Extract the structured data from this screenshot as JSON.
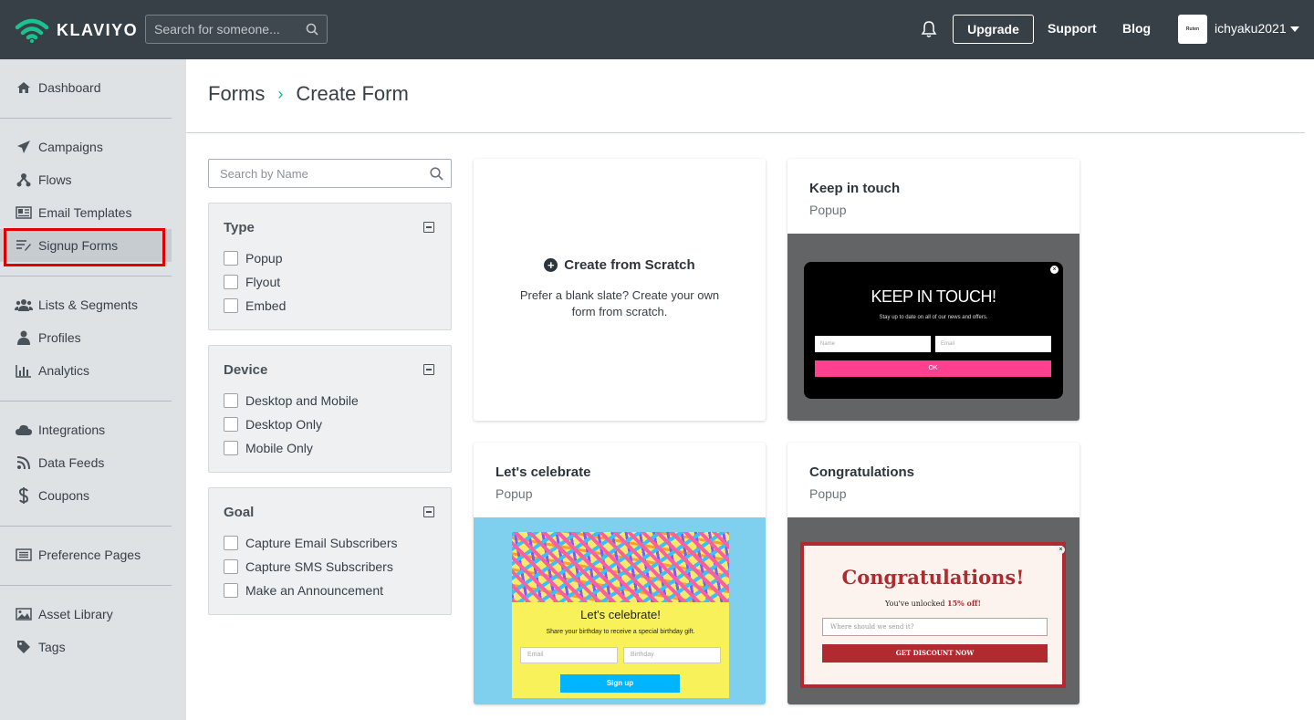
{
  "header": {
    "brand": "KLAVIYO",
    "search_placeholder": "Search for someone...",
    "upgrade_label": "Upgrade",
    "support_label": "Support",
    "blog_label": "Blog",
    "avatar_text": "Ruten",
    "username": "ichyaku2021"
  },
  "sidebar": {
    "items": [
      {
        "label": "Dashboard",
        "icon": "home-icon"
      },
      {
        "label": "Campaigns",
        "icon": "paper-plane-icon"
      },
      {
        "label": "Flows",
        "icon": "flows-icon"
      },
      {
        "label": "Email Templates",
        "icon": "template-icon"
      },
      {
        "label": "Signup Forms",
        "icon": "signup-forms-icon"
      },
      {
        "label": "Lists & Segments",
        "icon": "users-icon"
      },
      {
        "label": "Profiles",
        "icon": "user-icon"
      },
      {
        "label": "Analytics",
        "icon": "bar-chart-icon"
      },
      {
        "label": "Integrations",
        "icon": "cloud-icon"
      },
      {
        "label": "Data Feeds",
        "icon": "rss-icon"
      },
      {
        "label": "Coupons",
        "icon": "dollar-icon"
      },
      {
        "label": "Preference Pages",
        "icon": "list-alt-icon"
      },
      {
        "label": "Asset Library",
        "icon": "image-icon"
      },
      {
        "label": "Tags",
        "icon": "tag-icon"
      }
    ],
    "active": "Signup Forms"
  },
  "breadcrumb": {
    "parent": "Forms",
    "separator": "›",
    "current": "Create Form"
  },
  "filters": {
    "search_placeholder": "Search by Name",
    "groups": [
      {
        "title": "Type",
        "options": [
          "Popup",
          "Flyout",
          "Embed"
        ]
      },
      {
        "title": "Device",
        "options": [
          "Desktop and Mobile",
          "Desktop Only",
          "Mobile Only"
        ]
      },
      {
        "title": "Goal",
        "options": [
          "Capture Email Subscribers",
          "Capture SMS Subscribers",
          "Make an Announcement"
        ]
      }
    ]
  },
  "cards": {
    "scratch": {
      "title": "Create from Scratch",
      "description": "Prefer a blank slate? Create your own form from scratch."
    },
    "keep_in_touch": {
      "title": "Keep in touch",
      "subtitle": "Popup",
      "preview": {
        "headline": "KEEP IN TOUCH!",
        "sub": "Stay up to date on all of our news and offers.",
        "name_placeholder": "Name",
        "email_placeholder": "Email",
        "button": "OK"
      }
    },
    "celebrate": {
      "title": "Let's celebrate",
      "subtitle": "Popup",
      "preview": {
        "headline": "Let's celebrate!",
        "sub": "Share your birthday to receive a special birthday gift.",
        "email_placeholder": "Email",
        "birthday_placeholder": "Birthday",
        "button": "Sign up"
      }
    },
    "congratulations": {
      "title": "Congratulations",
      "subtitle": "Popup",
      "preview": {
        "headline": "Congratulations!",
        "sub_prefix": "You've unlocked",
        "sub_highlight": "15% off!",
        "input_placeholder": "Where should we send it?",
        "button": "GET DISCOUNT NOW"
      }
    }
  },
  "colors": {
    "topbar": "#373f47",
    "sidebar": "#dfe2e5",
    "accent": "#19b394",
    "highlight_box": "#e00000"
  }
}
